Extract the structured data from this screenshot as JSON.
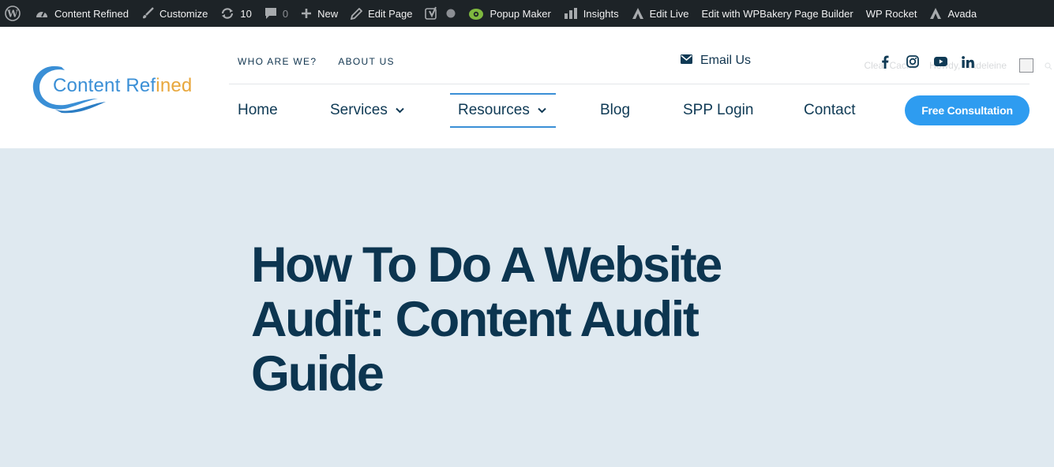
{
  "admin_bar": {
    "site_name": "Content Refined",
    "customize": "Customize",
    "updates_count": "10",
    "comments_count": "0",
    "new": "New",
    "edit_page": "Edit Page",
    "popup_maker": "Popup Maker",
    "insights": "Insights",
    "edit_live": "Edit Live",
    "wpbakery": "Edit with WPBakery Page Builder",
    "wp_rocket": "WP Rocket",
    "avada": "Avada",
    "clear_cache": "Clear Cache",
    "howdy": "Howdy, Madeleine"
  },
  "logo": {
    "text_a": "Content Ref",
    "text_b": "ined"
  },
  "topnav": {
    "who": "WHO ARE WE?",
    "about": "ABOUT US"
  },
  "email_us": "Email Us",
  "socials": [
    "facebook-icon",
    "instagram-icon",
    "youtube-icon",
    "linkedin-icon"
  ],
  "mainnav": {
    "home": "Home",
    "services": "Services",
    "resources": "Resources",
    "blog": "Blog",
    "spp": "SPP Login",
    "contact": "Contact"
  },
  "cta": "Free Consultation",
  "hero": {
    "title": "How To Do A Website Audit: Content Audit Guide"
  },
  "colors": {
    "adminbar": "#1d2327",
    "navy": "#0c3550",
    "accent": "#2e9cf0",
    "hero_bg": "#dfe9f0",
    "logo_orange": "#e8a73c"
  }
}
